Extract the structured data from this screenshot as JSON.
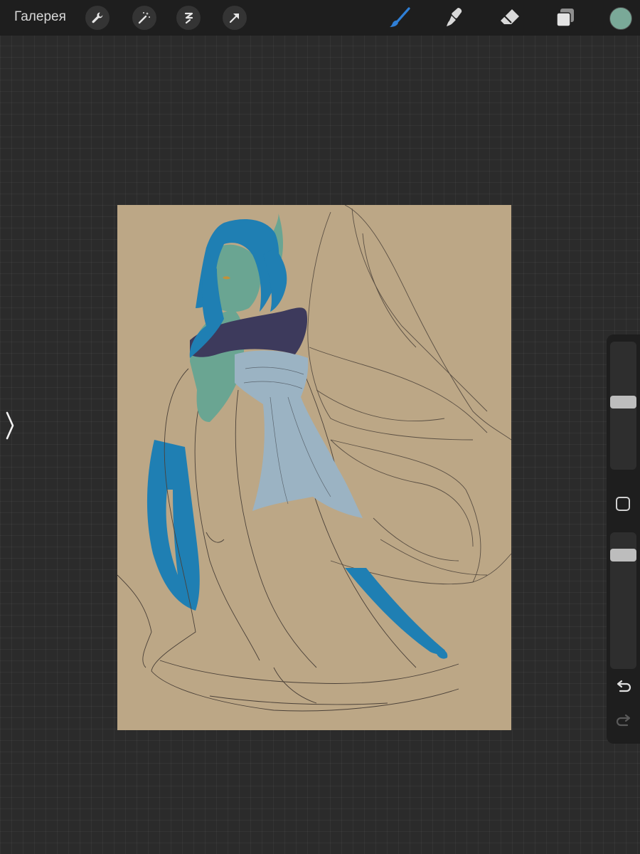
{
  "toolbar": {
    "gallery_label": "Галерея",
    "left_tools": [
      "wrench-icon",
      "magic-wand-icon",
      "selection-icon",
      "transform-arrow-icon"
    ],
    "right_tools": [
      "brush-icon",
      "smudge-icon",
      "eraser-icon",
      "layers-icon"
    ],
    "active_tool": "brush-icon",
    "active_tool_color": "#2f7fd6",
    "current_color": "#7aa998"
  },
  "side_panel": {
    "brush_size_level": 0.47,
    "opacity_level": 0.13,
    "buttons": [
      "modify-square-icon",
      "undo-icon",
      "redo-icon"
    ]
  },
  "canvas": {
    "background_color": "#bca786",
    "palette": {
      "hair": "#1f7fb3",
      "skin": "#6aa592",
      "scarf": "#3d3a5c",
      "sash": "#9bb3c3",
      "lineart": "#4a4038"
    }
  }
}
